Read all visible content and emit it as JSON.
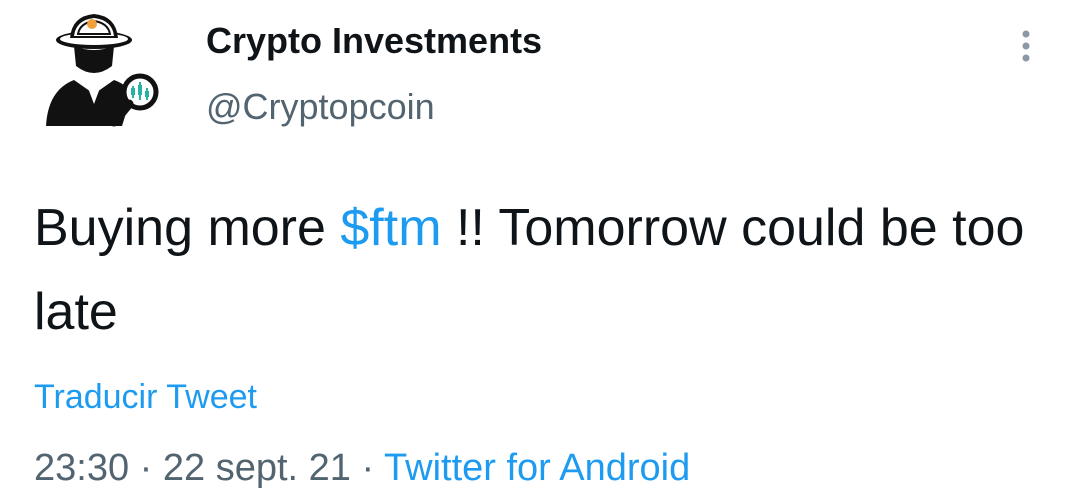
{
  "author": {
    "display_name": "Crypto Investments",
    "handle": "@Cryptopcoin",
    "avatar_icon": "detective-magnifier-avatar-icon"
  },
  "menu": {
    "icon": "more-vertical-icon"
  },
  "tweet": {
    "text_before": "Buying more ",
    "cashtag": "$ftm",
    "text_after": " !! Tomorrow could be too late"
  },
  "translate_label": "Traducir Tweet",
  "meta": {
    "time": "23:30",
    "separator": "·",
    "date": "22 sept. 21",
    "source": "Twitter for Android"
  },
  "colors": {
    "link": "#1d9bf0",
    "text": "#0f1419",
    "secondary": "#536471"
  }
}
